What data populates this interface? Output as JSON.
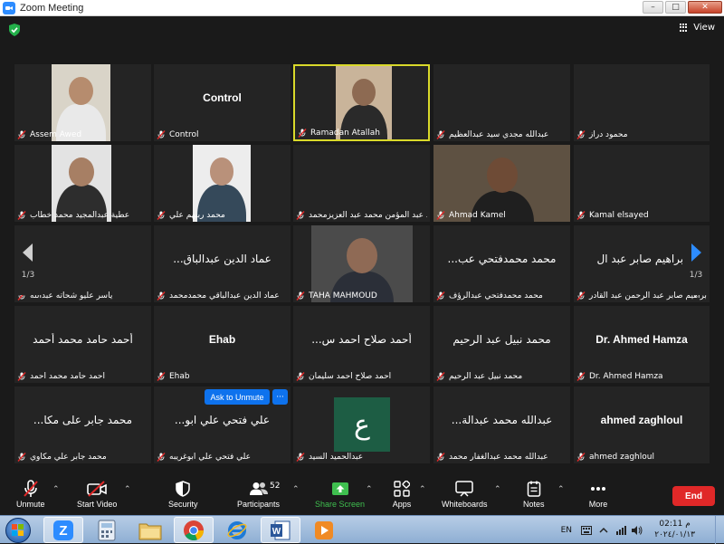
{
  "window": {
    "title": "Zoom Meeting",
    "controls": {
      "minimize": "–",
      "maximize": "□",
      "close": "✕"
    }
  },
  "view": {
    "label": "View"
  },
  "tiles": [
    {
      "center": "",
      "label": "Assem Awed",
      "video": true,
      "bold": false
    },
    {
      "center": "Control",
      "label": "Control",
      "video": false,
      "bold": true
    },
    {
      "center": "",
      "label": "Ramadan Atallah",
      "video": true,
      "bold": false,
      "active": true
    },
    {
      "center": "",
      "label": "عبدالله مجدي سيد عبدالعظيم",
      "video": false,
      "bold": false
    },
    {
      "center": "",
      "label": "محمود دراز",
      "video": false,
      "bold": false
    },
    {
      "center": "",
      "label": "عطية عبدالمجيد محمد خطاب",
      "video": true,
      "bold": false
    },
    {
      "center": "",
      "label": "محمد ربيهم علي",
      "video": true,
      "bold": false
    },
    {
      "center": "",
      "label": "أحمد عبد المؤمن محمد عبد العزيزمحمد",
      "video": false,
      "bold": false
    },
    {
      "center": "",
      "label": "Ahmad Kamel",
      "video": true,
      "bold": false
    },
    {
      "center": "",
      "label": "Kamal elsayed",
      "video": false,
      "bold": false
    },
    {
      "center": "",
      "label": "ياسر عليو شحاته عبدالله",
      "video": false,
      "bold": false
    },
    {
      "center": "...عماد الدين عبدالباق",
      "label": "عماد الدين عبدالباقي محمدمحمد",
      "video": false,
      "bold": false
    },
    {
      "center": "",
      "label": "TAHA MAHMOUD",
      "video": true,
      "bold": false
    },
    {
      "center": "...محمد محمدفتحي عب",
      "label": "محمد محمدفتحي عبدالرؤف",
      "video": false,
      "bold": false
    },
    {
      "center": "إبراهيم صابر عبد ال",
      "label": "إبراهيم صابر عبد الرحمن عبد القادر",
      "video": false,
      "bold": false
    },
    {
      "center": "أحمد حامد محمد أحمد",
      "label": "أحمد حامد محمد أحمد",
      "video": false,
      "bold": false
    },
    {
      "center": "Ehab",
      "label": "Ehab",
      "video": false,
      "bold": true
    },
    {
      "center": "...أحمد صلاح احمد س",
      "label": "أحمد صلاح احمد سليمان",
      "video": false,
      "bold": false
    },
    {
      "center": "محمد نبيل عبد الرحيم",
      "label": "محمد نبيل عبد الرحيم",
      "video": false,
      "bold": false
    },
    {
      "center": "Dr. Ahmed Hamza",
      "label": "Dr. Ahmed Hamza",
      "video": false,
      "bold": true
    },
    {
      "center": "...محمد جابر على مكا",
      "label": "محمد جابر علي مكاوي",
      "video": false,
      "bold": false
    },
    {
      "center": "...علي فتحي علي ابو",
      "label": "علي فتحي علي ابوغريبه",
      "video": false,
      "bold": false
    },
    {
      "center": "",
      "label": "عبدالحميد السيد",
      "video": false,
      "bold": false,
      "avatar": "ع"
    },
    {
      "center": "...عبدالله محمد عبدالة",
      "label": "عبدالله محمد عبدالغفار محمد",
      "video": false,
      "bold": false
    },
    {
      "center": "ahmed zaghloul",
      "label": "ahmed zaghloul",
      "video": false,
      "bold": true
    }
  ],
  "pagination": {
    "left": "1/3",
    "right": "1/3"
  },
  "hover_actions": {
    "ask_unmute": "Ask to Unmute",
    "more": "···"
  },
  "toolbar": {
    "unmute": "Unmute",
    "start_video": "Start Video",
    "security": "Security",
    "participants": "Participants",
    "participants_count": "52",
    "share_screen": "Share Screen",
    "apps": "Apps",
    "whiteboards": "Whiteboards",
    "notes": "Notes",
    "more": "More",
    "end": "End"
  },
  "taskbar": {
    "lang": "EN",
    "time": "02:11 م",
    "date": "٢٠٢٤/٠١/١٣"
  },
  "colors": {
    "tile_bg": "#242424",
    "active_border": "#d9d92a",
    "share_green": "#3fbf4f",
    "end_red": "#e02828",
    "ask_blue": "#0e72ed",
    "avatar_green": "#1d5d44"
  }
}
